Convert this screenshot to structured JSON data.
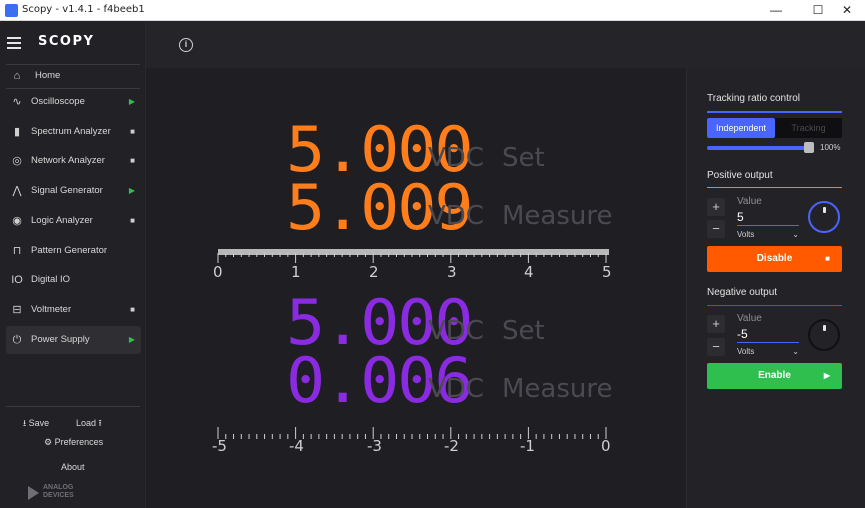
{
  "window": {
    "title": "Scopy - v1.4.1 - f4beeb1",
    "controls": {
      "minimize": "—",
      "maximize": "☐",
      "close": "✕"
    }
  },
  "sidebar": {
    "brand": "SCOPY",
    "home": {
      "label": "Home",
      "icon": "home-icon"
    },
    "items": [
      {
        "label": "Oscilloscope",
        "icon": "oscilloscope-icon",
        "state": "run",
        "state_glyph": "▶"
      },
      {
        "label": "Spectrum Analyzer",
        "icon": "spectrum-analyzer-icon",
        "state": "stop",
        "state_glyph": "■"
      },
      {
        "label": "Network Analyzer",
        "icon": "network-analyzer-icon",
        "state": "stop",
        "state_glyph": "■"
      },
      {
        "label": "Signal Generator",
        "icon": "signal-generator-icon",
        "state": "run",
        "state_glyph": "▶"
      },
      {
        "label": "Logic Analyzer",
        "icon": "logic-analyzer-icon",
        "state": "stop",
        "state_glyph": "■"
      },
      {
        "label": "Pattern Generator",
        "icon": "pattern-generator-icon",
        "state": "none",
        "state_glyph": ""
      },
      {
        "label": "Digital IO",
        "icon": "digital-io-icon",
        "state": "none",
        "state_glyph": ""
      },
      {
        "label": "Voltmeter",
        "icon": "voltmeter-icon",
        "state": "stop",
        "state_glyph": "■"
      },
      {
        "label": "Power Supply",
        "icon": "power-supply-icon",
        "state": "run",
        "state_glyph": "▶",
        "active": true
      }
    ],
    "save": "Save",
    "load": "Load",
    "preferences": "Preferences",
    "about": "About",
    "logo": {
      "line1": "ANALOG",
      "line2": "DEVICES"
    }
  },
  "positive_display": {
    "set_value": "5.000",
    "measure_value": "5.009",
    "unit": "VDC",
    "set_tag": "Set",
    "measure_tag": "Measure",
    "color": "#ff7d1a",
    "scale_labels": [
      "0",
      "1",
      "2",
      "3",
      "4",
      "5"
    ]
  },
  "negative_display": {
    "set_value": "5.000",
    "measure_value": "0.006",
    "unit": "VDC",
    "set_tag": "Set",
    "measure_tag": "Measure",
    "color": "#8a2be2",
    "scale_labels": [
      "-5",
      "-4",
      "-3",
      "-2",
      "-1",
      "0"
    ]
  },
  "panel": {
    "tracking": {
      "title": "Tracking ratio control",
      "independent": "Independent",
      "tracking": "Tracking",
      "ratio_percent": "100%",
      "ratio_fraction": 1.0
    },
    "positive": {
      "title": "Positive output",
      "value_label": "Value",
      "value": "5",
      "unit": "Volts",
      "button": "Disable",
      "button_color": "#ff5a00",
      "accent": "#ff7d1a",
      "knob_color": "#4a64ff"
    },
    "negative": {
      "title": "Negative output",
      "value_label": "Value",
      "value": "-5",
      "unit": "Volts",
      "button": "Enable",
      "button_color": "#2fbf4e",
      "accent": "#8a2be2",
      "knob_color": "#111111"
    }
  }
}
